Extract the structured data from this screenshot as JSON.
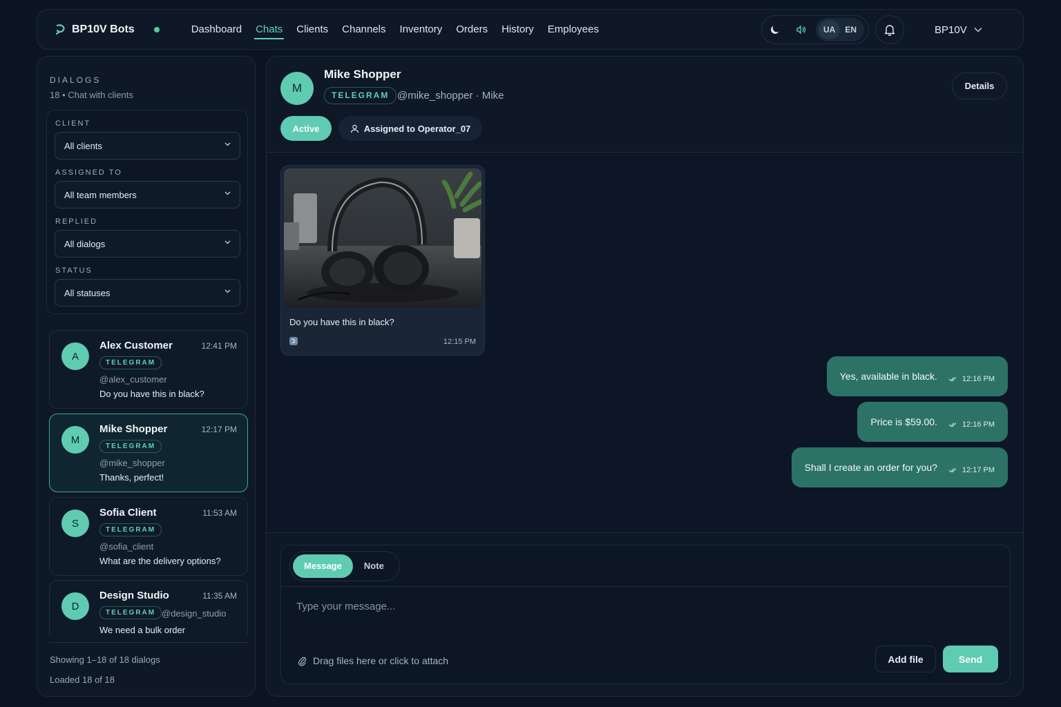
{
  "brand": {
    "name": "BP10V Bots",
    "logo_icon": "bot-logo-icon",
    "online_color": "#4fcf9e"
  },
  "nav": [
    {
      "label": "Dashboard",
      "active": false
    },
    {
      "label": "Chats",
      "active": true
    },
    {
      "label": "Clients",
      "active": false
    },
    {
      "label": "Channels",
      "active": false
    },
    {
      "label": "Inventory",
      "active": false
    },
    {
      "label": "Orders",
      "active": false
    },
    {
      "label": "History",
      "active": false
    },
    {
      "label": "Employees",
      "active": false
    }
  ],
  "controls": {
    "lang_ua": "UA",
    "lang_en": "EN",
    "account": "BP10V"
  },
  "sidebar": {
    "title": "DIALOGS",
    "subtitle": "18 • Chat with clients",
    "filters": [
      {
        "label": "CLIENT",
        "value": "All clients"
      },
      {
        "label": "ASSIGNED TO",
        "value": "All team members"
      },
      {
        "label": "REPLIED",
        "value": "All dialogs"
      },
      {
        "label": "STATUS",
        "value": "All statuses"
      }
    ],
    "dialogs": [
      {
        "initial": "A",
        "name": "Alex Customer",
        "time": "12:41 PM",
        "channel": "TELEGRAM",
        "handle": "@alex_customer",
        "message": "Do you have this in black?"
      },
      {
        "initial": "M",
        "name": "Mike Shopper",
        "time": "12:17 PM",
        "channel": "TELEGRAM",
        "handle": "@mike_shopper",
        "message": "Thanks, perfect!"
      },
      {
        "initial": "S",
        "name": "Sofia Client",
        "time": "11:53 AM",
        "channel": "TELEGRAM",
        "handle": "@sofia_client",
        "message": "What are the delivery options?"
      },
      {
        "initial": "D",
        "name": "Design Studio",
        "time": "11:35 AM",
        "channel": "TELEGRAM",
        "handle": "@design_studio",
        "message": "We need a bulk order"
      }
    ],
    "footer_showing": "Showing 1–18 of 18 dialogs",
    "footer_loaded": "Loaded 18 of 18"
  },
  "chat": {
    "initial": "M",
    "name": "Mike Shopper",
    "channel": "TELEGRAM",
    "handle": "@mike_shopper · Mike",
    "details_label": "Details",
    "status": "Active",
    "assigned": "Assigned to Operator_07",
    "incoming": {
      "text": "Do you have this in black?",
      "time": "12:15 PM"
    },
    "outgoing": [
      {
        "text": "Yes, available in black.",
        "time": "12:16 PM"
      },
      {
        "text": "Price is $59.00.",
        "time": "12:16 PM"
      },
      {
        "text": "Shall I create an order for you?",
        "time": "12:17 PM"
      }
    ]
  },
  "composer": {
    "mode_message": "Message",
    "mode_note": "Note",
    "placeholder": "Type your message...",
    "attach_hint": "Drag files here or click to attach",
    "add_file": "Add file",
    "send": "Send"
  },
  "colors": {
    "accent": "#5fcbb3",
    "outgoing_bubble": "#2c7267",
    "background": "#0b1422"
  }
}
